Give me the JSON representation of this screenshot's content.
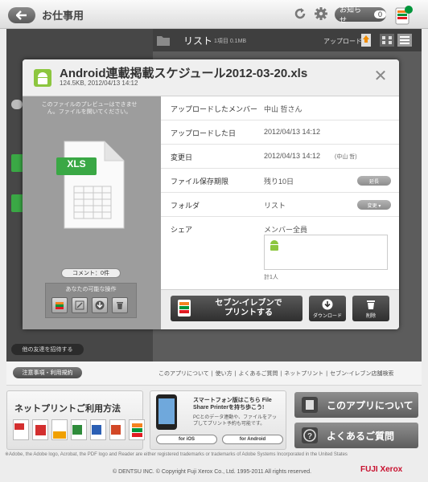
{
  "header": {
    "title": "お仕事用",
    "notice_label": "お知らせ",
    "notice_count": "0"
  },
  "toolbar": {
    "list_label": "リスト",
    "list_meta": "1項目 0.1MB",
    "upload_label": "アップロード"
  },
  "sidebar": {
    "invite_label": "他の友達を招待する"
  },
  "modal": {
    "filename": "Android連載掲載スケジュール2012-03-20.xls",
    "filemeta": "124.5KB, 2012/04/13 14:12",
    "close_symbol": "✕",
    "preview_text": "このファイルのプレビューはできません。ファイルを開いてください。",
    "file_type": "XLS",
    "comments_label": "コメント：0件",
    "ops_label": "あなたの可能な操作",
    "rows": [
      {
        "label": "アップロードしたメンバー",
        "value": "中山 哲さん"
      },
      {
        "label": "アップロードした日",
        "value": "2012/04/13 14:12"
      },
      {
        "label": "変更日",
        "value": "2012/04/13 14:12",
        "note": "(中山 哲)"
      },
      {
        "label": "ファイル保存期限",
        "value": "残り10日",
        "button": "延長"
      },
      {
        "label": "フォルダ",
        "value": "リスト",
        "button": "変更 ▾"
      },
      {
        "label": "シェア",
        "value": "メンバー全員"
      }
    ],
    "share_count": "計1人",
    "print_label_line1": "セブン-イレブンで",
    "print_label_line2": "プリントする",
    "download_label": "ダウンロード",
    "delete_label": "削除"
  },
  "footer": {
    "terms_label": "注意事項・利用規約",
    "links": [
      "このアプリについて",
      "使い方",
      "よくあるご質問",
      "ネットプリント",
      "セブン-イレブン店舗検索"
    ],
    "howto_title": "ネットプリントご利用方法",
    "phone_title": "スマートフォン版はこちら File Share Printerを持ち歩こう!",
    "phone_sub": "PCとのデータ連動や、ファイルをアップしてプリント予約も可能です。",
    "ios_label": "for iOS",
    "android_label": "for Android",
    "about_label": "このアプリについて",
    "faq_label": "よくあるご質問",
    "disclaimer": "※Adobe, the Adobe logo, Acrobat, the PDF logo and Reader are either registered trademarks or trademarks of Adobe Systems Incorporated in the United States",
    "copyright": "© DENTSU INC.   © Copyright Fuji Xerox Co., Ltd. 1995-2011 All rights reserved.",
    "logo_text": "FUJI Xerox"
  },
  "colors": {
    "xls_green": "#3aa845",
    "android_green": "#8cc63f",
    "brand_red": "#c8102e"
  }
}
